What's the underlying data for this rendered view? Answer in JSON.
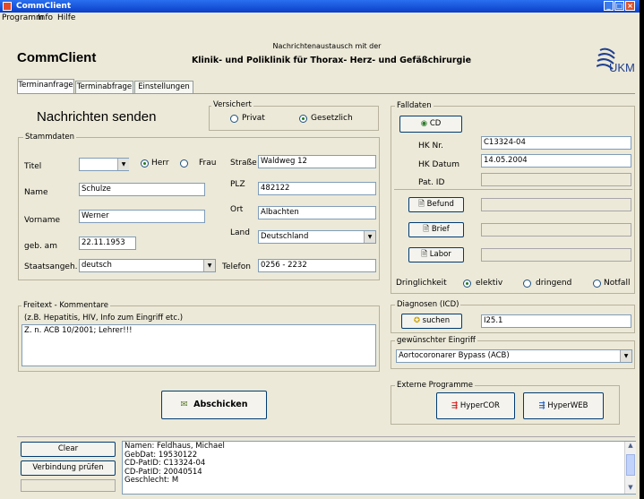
{
  "window": {
    "title": "CommClient"
  },
  "menu": [
    "Programm",
    "Info",
    "Hilfe"
  ],
  "header": {
    "app_name": "CommClient",
    "subtitle_small": "Nachrichtenaustausch mit der",
    "subtitle_big": "Klinik- und Poliklinik für Thorax- Herz- und Gefäßchirurgie",
    "logo_text": "UKM"
  },
  "tabs": [
    "Terminanfrage",
    "Terminabfrage",
    "Einstellungen"
  ],
  "heading": "Nachrichten senden",
  "versichert": {
    "label": "Versichert",
    "privat": "Privat",
    "gesetzlich": "Gesetzlich",
    "selected": "gesetzlich"
  },
  "stammdaten": {
    "label": "Stammdaten",
    "titel_label": "Titel",
    "titel_value": "",
    "herr": "Herr",
    "frau": "Frau",
    "selected": "herr",
    "name_label": "Name",
    "name_value": "Schulze",
    "vorname_label": "Vorname",
    "vorname_value": "Werner",
    "geb_label": "geb. am",
    "geb_value": "22.11.1953",
    "staat_label": "Staatsangeh.",
    "staat_value": "deutsch",
    "strasse_label": "Straße",
    "strasse_value": "Waldweg 12",
    "plz_label": "PLZ",
    "plz_value": "482122",
    "ort_label": "Ort",
    "ort_value": "Albachten",
    "land_label": "Land",
    "land_value": "Deutschland",
    "telefon_label": "Telefon",
    "telefon_value": "0256 - 2232"
  },
  "falldaten": {
    "label": "Falldaten",
    "cd_button": "CD",
    "hknr_label": "HK Nr.",
    "hknr_value": "C13324-04",
    "hkdatum_label": "HK Datum",
    "hkdatum_value": "14.05.2004",
    "patid_label": "Pat. ID",
    "patid_value": "",
    "befund_button": "Befund",
    "brief_button": "Brief",
    "labor_button": "Labor",
    "dringlichkeit_label": "Dringlichkeit",
    "elektiv": "elektiv",
    "dringend": "dringend",
    "notfall": "Notfall",
    "selected": "elektiv"
  },
  "freitext": {
    "label": "Freitext - Kommentare",
    "hint": "(z.B. Hepatitis, HIV, Info zum Eingriff etc.)",
    "value": "Z. n. ACB 10/2001; Lehrer!!!"
  },
  "diagnosen": {
    "label": "Diagnosen (ICD)",
    "button": "suchen",
    "value": "I25.1"
  },
  "eingriff": {
    "label": "gewünschter Eingriff",
    "value": "Aortocoronarer Bypass (ACB)"
  },
  "externe": {
    "label": "Externe Programme",
    "hypercor": "HyperCOR",
    "hyperweb": "HyperWEB"
  },
  "send_button": "Abschicken",
  "bottom": {
    "clear_button": "Clear",
    "verbindung_button": "Verbindung prüfen",
    "log_lines": [
      "Namen: Feldhaus, Michael",
      "GebDat: 19530122",
      "CD-PatID: C13324-04",
      "CD-PatID: 20040514",
      "Geschlecht: M"
    ]
  },
  "colors": {
    "window_bg": "#ece9d8",
    "titlebar": "#0a3fc8",
    "input_border": "#7f9db9"
  }
}
